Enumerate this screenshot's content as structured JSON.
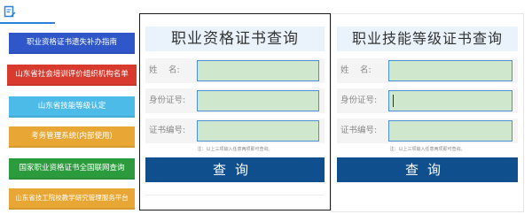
{
  "sidebar": {
    "items": [
      {
        "label": "职业资格证书遗失补办指南",
        "color": "#2f57c9"
      },
      {
        "label": "山东省社会培训评价组织机构名单",
        "color": "#d83a2e"
      },
      {
        "label": "山东省技能等级认定",
        "color": "#4dbbe8"
      },
      {
        "label": "考务管理系统(内部使用)",
        "color": "#e8a735"
      },
      {
        "label": "国家职业资格证书全国联网查询",
        "color": "#2c9b3e"
      },
      {
        "label": "山东省技工院校教学研究管理服务平台",
        "color": "#e8a735"
      }
    ]
  },
  "panel_vocational": {
    "title": "职业资格证书查询",
    "fields": [
      {
        "label": "姓　 名:",
        "value": ""
      },
      {
        "label": "身份证号:",
        "value": ""
      },
      {
        "label": "证书编号:",
        "value": ""
      }
    ],
    "note": "注：以上三项输入任意两项即可查询。",
    "button": "查询"
  },
  "panel_skill": {
    "title": "职业技能等级证书查询",
    "fields": [
      {
        "label": "姓　 名:",
        "value": ""
      },
      {
        "label": "身份证号:",
        "value": ""
      },
      {
        "label": "证书编号:",
        "value": ""
      }
    ],
    "note": "注：以上三项输入任意两项即可查询。",
    "button": "查询"
  },
  "colors": {
    "title_bg": "#eaf3fb",
    "input_bg": "#cfe7cd",
    "input_border": "#4a90d9",
    "query_button": "#0f4f8e",
    "tab_underline": "#2e7fd8"
  }
}
